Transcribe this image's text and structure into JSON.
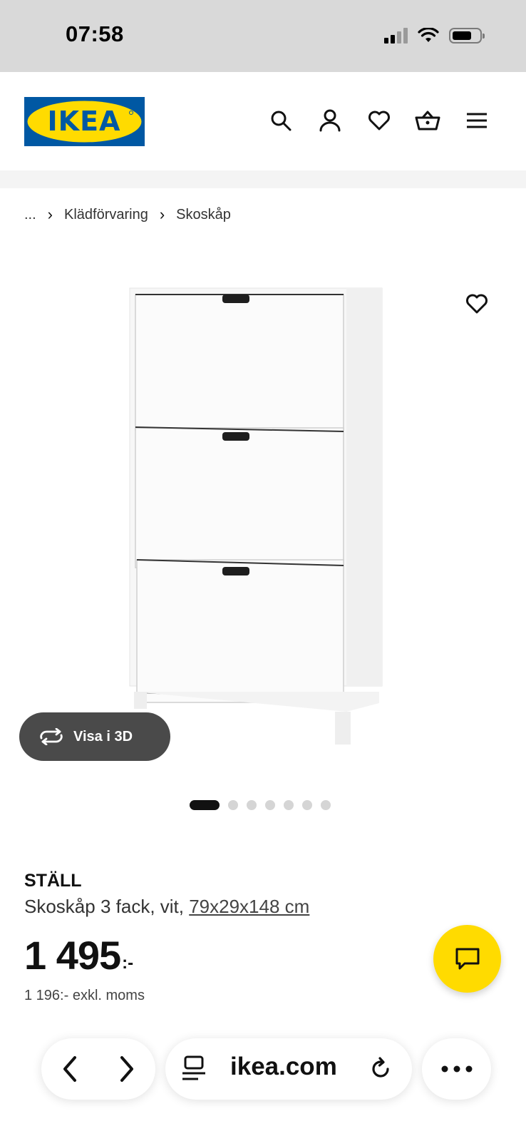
{
  "status_bar": {
    "time": "07:58"
  },
  "header": {
    "logo_text": "IKEA",
    "brand_blue": "#0058a3",
    "brand_yellow": "#ffdb00"
  },
  "breadcrumb": {
    "items": [
      "...",
      "Klädförvaring",
      "Skoskåp"
    ]
  },
  "gallery": {
    "visa3d_label": "Visa i 3D",
    "page_count": 7,
    "active_page": 1
  },
  "product": {
    "name": "STÄLL",
    "description_prefix": "Skoskåp 3 fack, vit, ",
    "dimensions": "79x29x148 cm",
    "price": "1 495",
    "price_suffix": ":-",
    "price_excl_vat": "1 196:- exkl. moms"
  },
  "browser": {
    "url": "ikea.com"
  },
  "icons": {
    "search": "search-icon",
    "account": "user-icon",
    "favourites": "heart-icon",
    "cart": "basket-icon",
    "menu": "hamburger-icon",
    "rotate3d": "rotate-arrows-icon",
    "chat": "chat-bubble-icon"
  }
}
